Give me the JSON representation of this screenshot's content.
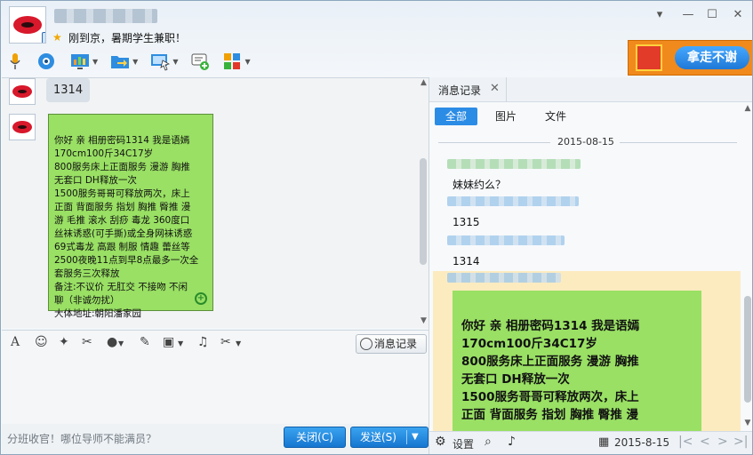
{
  "header": {
    "status_text": "刚到京，暑期学生兼职！",
    "promo_button": "拿走不谢"
  },
  "window_controls": [
    "▾",
    "—",
    "☐",
    "✕"
  ],
  "toolbar_icons": [
    "microphone-icon",
    "video-icon",
    "screen-share-icon",
    "file-transfer-icon",
    "remote-desktop-icon",
    "add-app-icon",
    "apps-grid-icon"
  ],
  "chat": {
    "message_1": "1314",
    "message_2_lines": [
      "你好 亲 相册密码1314 我是语嫣",
      "170cm100斤34C17岁",
      "800服务床上正面服务 漫游 胸推",
      "无套口 DH释放一次",
      "1500服务哥哥可释放两次，床上",
      "正面 背面服务 指划 胸推 臀推 漫",
      "游 毛推 滚水 刮痧 毒龙 360度口",
      "丝袜诱惑(可手撕)或全身网袜诱惑",
      "69式毒龙 高跟 制服 情趣 蕾丝等",
      "2500夜晚11点到早8点最多一次全",
      "套服务三次释放",
      "备注:不议价 无肛交  不接吻 不闲",
      "聊（非诚勿扰）",
      "大体地址:朝阳潘家园"
    ]
  },
  "input_toolbar": {
    "history_label": "消息记录"
  },
  "footer": {
    "hint": "分班收官！哪位导师不能满员？",
    "close_label": "关闭(C)",
    "send_label": "发送(S)"
  },
  "history_panel": {
    "tab_label": "消息记录",
    "filters": [
      "全部",
      "图片",
      "文件"
    ],
    "date": "2015-08-15",
    "messages": [
      "妹妹约么？",
      "1315",
      "1314"
    ],
    "preview_lines": [
      "你好 亲 相册密码1314 我是语嫣",
      "170cm100斤34C17岁",
      "800服务床上正面服务 漫游 胸推",
      "无套口 DH释放一次",
      "1500服务哥哥可释放两次，床上",
      "正面 背面服务 指划 胸推 臀推 漫"
    ],
    "settings_label": "设置",
    "footer_date": "2015-8-15"
  }
}
